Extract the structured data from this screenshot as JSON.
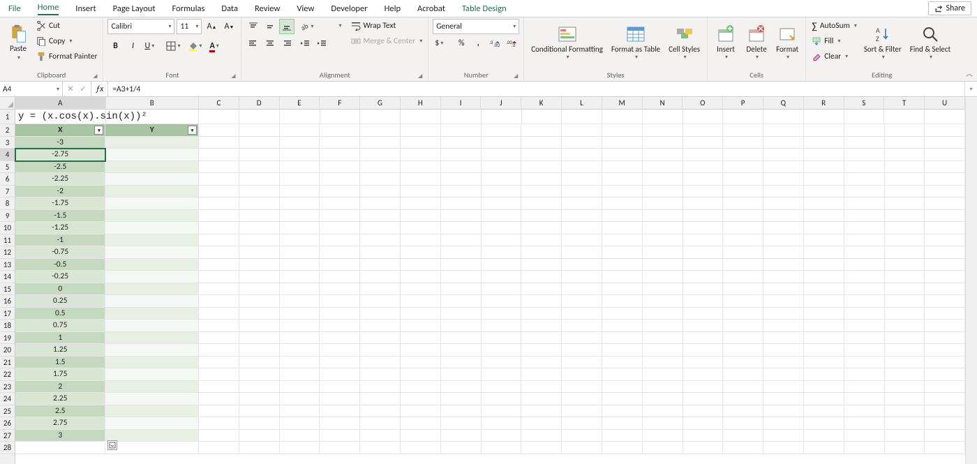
{
  "tabs": [
    "File",
    "Home",
    "Insert",
    "Page Layout",
    "Formulas",
    "Data",
    "Review",
    "View",
    "Developer",
    "Help",
    "Acrobat",
    "Table Design"
  ],
  "active_tab": "Home",
  "share": "Share",
  "clipboard": {
    "paste": "Paste",
    "cut": "Cut",
    "copy": "Copy",
    "fp": "Format Painter",
    "label": "Clipboard"
  },
  "font": {
    "name": "Calibri",
    "size": "11",
    "label": "Font"
  },
  "alignment": {
    "wrap": "Wrap Text",
    "merge": "Merge & Center",
    "label": "Alignment"
  },
  "number": {
    "format": "General",
    "label": "Number"
  },
  "styles": {
    "cf": "Conditional Formatting",
    "fat": "Format as Table",
    "cs": "Cell Styles",
    "label": "Styles"
  },
  "cells": {
    "insert": "Insert",
    "delete": "Delete",
    "format": "Format",
    "label": "Cells"
  },
  "editing": {
    "autosum": "AutoSum",
    "fill": "Fill",
    "clear": "Clear",
    "sort": "Sort & Filter",
    "find": "Find & Select",
    "label": "Editing"
  },
  "name_box": "A4",
  "formula": "=A3+1/4",
  "columns": [
    "A",
    "B",
    "C",
    "D",
    "E",
    "F",
    "G",
    "H",
    "I",
    "J",
    "K",
    "L",
    "M",
    "N",
    "O",
    "P",
    "Q",
    "R",
    "S",
    "T",
    "U"
  ],
  "col_widths": {
    "A": 130,
    "B": 134,
    "default": 58
  },
  "row_count": 28,
  "active_cell": {
    "row": 4,
    "col": "A"
  },
  "sheet": {
    "title_cell": "y = (x.cos(x).sin(x))²",
    "headers": {
      "A": "X",
      "B": "Y"
    },
    "colA": [
      "-3",
      "-2.75",
      "-2.5",
      "-2.25",
      "-2",
      "-1.75",
      "-1.5",
      "-1.25",
      "-1",
      "-0.75",
      "-0.5",
      "-0.25",
      "0",
      "0.25",
      "0.5",
      "0.75",
      "1",
      "1.25",
      "1.5",
      "1.75",
      "2",
      "2.25",
      "2.5",
      "2.75",
      "3"
    ]
  },
  "chart_data": {
    "type": "table",
    "title": "y = (x.cos(x).sin(x))²",
    "columns": [
      "X",
      "Y"
    ],
    "x": [
      -3,
      -2.75,
      -2.5,
      -2.25,
      -2,
      -1.75,
      -1.5,
      -1.25,
      -1,
      -0.75,
      -0.5,
      -0.25,
      0,
      0.25,
      0.5,
      0.75,
      1,
      1.25,
      1.5,
      1.75,
      2,
      2.25,
      2.5,
      2.75,
      3
    ],
    "y": []
  }
}
